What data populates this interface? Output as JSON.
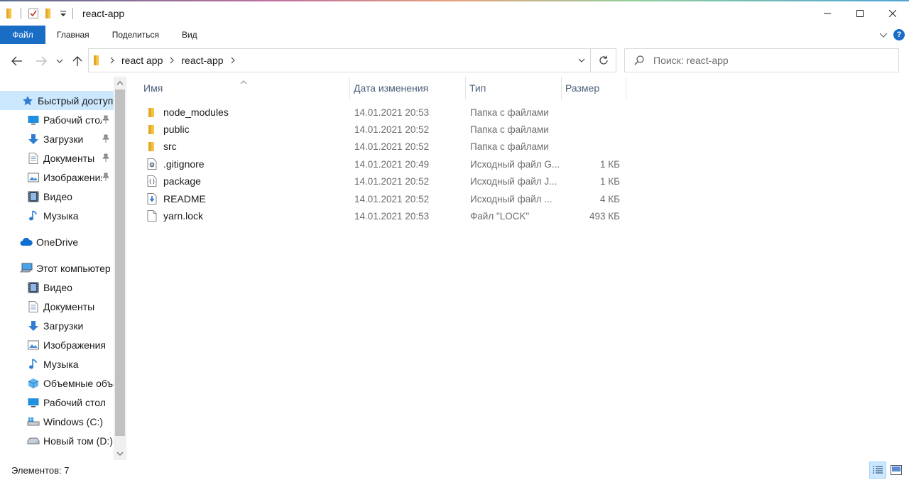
{
  "window": {
    "title": "react-app"
  },
  "ribbon": {
    "tabs": [
      "Файл",
      "Главная",
      "Поделиться",
      "Вид"
    ],
    "help": "?"
  },
  "address": {
    "crumbs": [
      "react app",
      "react-app"
    ]
  },
  "search": {
    "placeholder": "Поиск: react-app"
  },
  "nav": {
    "items": [
      {
        "label": "Быстрый доступ",
        "icon": "star-icon",
        "selected": true,
        "pinned": false
      },
      {
        "label": "Рабочий стол",
        "icon": "desktop-icon",
        "pinned": true
      },
      {
        "label": "Загрузки",
        "icon": "download-icon",
        "pinned": true
      },
      {
        "label": "Документы",
        "icon": "documents-icon",
        "pinned": true
      },
      {
        "label": "Изображения",
        "icon": "pictures-icon",
        "pinned": true
      },
      {
        "label": "Видео",
        "icon": "video-icon",
        "pinned": false
      },
      {
        "label": "Музыка",
        "icon": "music-icon",
        "pinned": false
      },
      {
        "label": "OneDrive",
        "icon": "cloud-icon",
        "pinned": false
      },
      {
        "label": "Этот компьютер",
        "icon": "computer-icon",
        "pinned": false
      },
      {
        "label": "Видео",
        "icon": "video-icon",
        "pinned": false
      },
      {
        "label": "Документы",
        "icon": "documents-icon",
        "pinned": false
      },
      {
        "label": "Загрузки",
        "icon": "download-icon",
        "pinned": false
      },
      {
        "label": "Изображения",
        "icon": "pictures-icon",
        "pinned": false
      },
      {
        "label": "Музыка",
        "icon": "music-icon",
        "pinned": false
      },
      {
        "label": "Объемные объекты",
        "icon": "3d-objects-icon",
        "pinned": false
      },
      {
        "label": "Рабочий стол",
        "icon": "desktop-icon",
        "pinned": false
      },
      {
        "label": "Windows (C:)",
        "icon": "windows-drive-icon",
        "pinned": false
      },
      {
        "label": "Новый том (D:)",
        "icon": "drive-icon",
        "pinned": false
      }
    ]
  },
  "columns": {
    "name": "Имя",
    "date": "Дата изменения",
    "type": "Тип",
    "size": "Размер"
  },
  "files": [
    {
      "name": "node_modules",
      "date": "14.01.2021 20:53",
      "type": "Папка с файлами",
      "size": "",
      "icon": "folder-icon"
    },
    {
      "name": "public",
      "date": "14.01.2021 20:52",
      "type": "Папка с файлами",
      "size": "",
      "icon": "folder-icon"
    },
    {
      "name": "src",
      "date": "14.01.2021 20:52",
      "type": "Папка с файлами",
      "size": "",
      "icon": "folder-icon"
    },
    {
      "name": ".gitignore",
      "date": "14.01.2021 20:49",
      "type": "Исходный файл G...",
      "size": "1 КБ",
      "icon": "gear-file-icon"
    },
    {
      "name": "package",
      "date": "14.01.2021 20:52",
      "type": "Исходный файл J...",
      "size": "1 КБ",
      "icon": "json-file-icon"
    },
    {
      "name": "README",
      "date": "14.01.2021 20:52",
      "type": "Исходный файл ...",
      "size": "4 КБ",
      "icon": "markdown-file-icon"
    },
    {
      "name": "yarn.lock",
      "date": "14.01.2021 20:53",
      "type": "Файл \"LOCK\"",
      "size": "493 КБ",
      "icon": "blank-file-icon"
    }
  ],
  "status": {
    "text": "Элементов: 7"
  },
  "colors": {
    "accent": "#1a6dc5",
    "selection": "#cce8ff",
    "folder": "#f5c242",
    "header_text": "#4c607a"
  }
}
